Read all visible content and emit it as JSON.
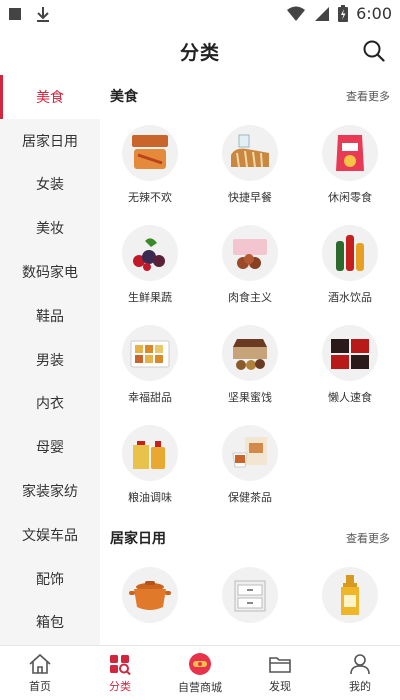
{
  "status_bar": {
    "time": "6:00"
  },
  "header": {
    "title": "分类"
  },
  "sidebar": {
    "items": [
      {
        "label": "美食",
        "active": true
      },
      {
        "label": "居家日用"
      },
      {
        "label": "女装"
      },
      {
        "label": "美妆"
      },
      {
        "label": "数码家电"
      },
      {
        "label": "鞋品"
      },
      {
        "label": "男装"
      },
      {
        "label": "内衣"
      },
      {
        "label": "母婴"
      },
      {
        "label": "家装家纺"
      },
      {
        "label": "文娱车品"
      },
      {
        "label": "配饰"
      },
      {
        "label": "箱包"
      }
    ]
  },
  "sections": [
    {
      "title": "美食",
      "more": "查看更多",
      "items": [
        {
          "label": "无辣不欢",
          "icon": "spicy-snack-icon"
        },
        {
          "label": "快捷早餐",
          "icon": "bread-icon"
        },
        {
          "label": "休闲零食",
          "icon": "snack-bag-icon"
        },
        {
          "label": "生鲜果蔬",
          "icon": "fruit-icon"
        },
        {
          "label": "肉食主义",
          "icon": "meat-icon"
        },
        {
          "label": "酒水饮品",
          "icon": "drinks-icon"
        },
        {
          "label": "幸福甜品",
          "icon": "dessert-icon"
        },
        {
          "label": "坚果蜜饯",
          "icon": "nuts-icon"
        },
        {
          "label": "懒人速食",
          "icon": "instant-food-icon"
        },
        {
          "label": "粮油调味",
          "icon": "oil-icon"
        },
        {
          "label": "保健茶品",
          "icon": "tea-icon"
        }
      ]
    },
    {
      "title": "居家日用",
      "more": "查看更多",
      "items": [
        {
          "label": "",
          "icon": "pot-icon"
        },
        {
          "label": "",
          "icon": "storage-box-icon"
        },
        {
          "label": "",
          "icon": "shampoo-icon"
        }
      ]
    }
  ],
  "tabbar": {
    "tabs": [
      {
        "label": "首页",
        "icon": "home-icon"
      },
      {
        "label": "分类",
        "icon": "category-icon",
        "active": true
      },
      {
        "label": "自营商城",
        "icon": "mall-icon"
      },
      {
        "label": "发现",
        "icon": "folder-icon"
      },
      {
        "label": "我的",
        "icon": "user-icon"
      }
    ]
  },
  "colors": {
    "accent": "#d2263f",
    "sidebar_bg": "#f5f5f5"
  }
}
